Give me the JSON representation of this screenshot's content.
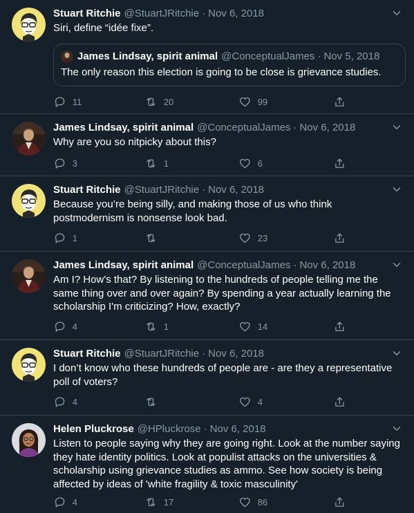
{
  "tweets": [
    {
      "avatar": "cartoon-portrait-yellow",
      "name": "Stuart Ritchie",
      "handle": "@StuartJRitchie",
      "date": "Nov 6, 2018",
      "text": "Siri, define “idée fixe”.",
      "quote": {
        "avatar": "photo-portrait",
        "name": "James Lindsay, spirit animal",
        "handle": "@ConceptualJames",
        "date": "Nov 5, 2018",
        "text": "The only reason this election is going to be close is grievance studies."
      },
      "replies": "11",
      "retweets": "20",
      "likes": "99"
    },
    {
      "avatar": "photo-portrait",
      "name": "James Lindsay, spirit animal",
      "handle": "@ConceptualJames",
      "date": "Nov 6, 2018",
      "text": "Why are you so nitpicky about this?",
      "replies": "3",
      "retweets": "1",
      "likes": "6"
    },
    {
      "avatar": "cartoon-portrait-yellow",
      "name": "Stuart Ritchie",
      "handle": "@StuartJRitchie",
      "date": "Nov 6, 2018",
      "text": "Because you’re being silly, and making those of us who think postmodernism is nonsense look bad.",
      "replies": "1",
      "retweets": "",
      "likes": "23"
    },
    {
      "avatar": "photo-portrait",
      "name": "James Lindsay, spirit animal",
      "handle": "@ConceptualJames",
      "date": "Nov 6, 2018",
      "text": "Am I? How's that? By listening to the hundreds of people telling me the same thing over and over again? By spending a year actually learning the scholarship I'm criticizing? How, exactly?",
      "replies": "4",
      "retweets": "1",
      "likes": "14"
    },
    {
      "avatar": "cartoon-portrait-yellow",
      "name": "Stuart Ritchie",
      "handle": "@StuartJRitchie",
      "date": "Nov 6, 2018",
      "text": "I don’t know who these hundreds of people are - are they a representative poll of voters?",
      "replies": "4",
      "retweets": "",
      "likes": "4"
    },
    {
      "avatar": "photo-portrait-glasses",
      "name": "Helen Pluckrose",
      "handle": "@HPluckrose",
      "date": "Nov 6, 2018",
      "text": "Listen to people saying why they are going right. Look at the number saying they hate identity politics. Look at populist attacks on the universities & scholarship using grievance studies as ammo. See how society is being affected by ideas of 'white fragility & toxic masculinity'",
      "replies": "4",
      "retweets": "17",
      "likes": "86"
    }
  ],
  "icons": {
    "reply": "reply-icon",
    "retweet": "retweet-icon",
    "like": "like-icon",
    "share": "share-icon",
    "more": "chevron-down-icon"
  },
  "colors": {
    "background": "#15202b",
    "text": "#ffffff",
    "muted": "#8899a6",
    "border": "#38444d"
  }
}
